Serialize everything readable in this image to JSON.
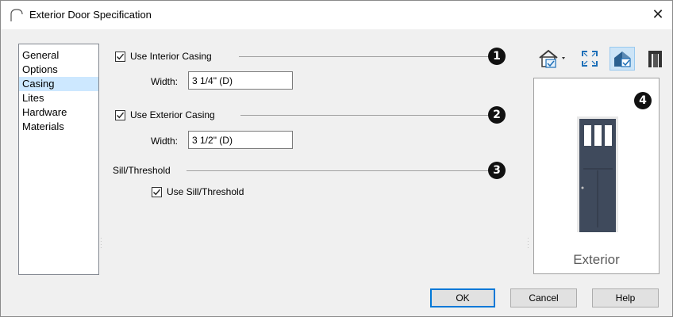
{
  "window": {
    "title": "Exterior Door Specification",
    "close_glyph": "✕"
  },
  "nav": {
    "items": [
      {
        "label": "General",
        "selected": false
      },
      {
        "label": "Options",
        "selected": false
      },
      {
        "label": "Casing",
        "selected": true
      },
      {
        "label": "Lites",
        "selected": false
      },
      {
        "label": "Hardware",
        "selected": false
      },
      {
        "label": "Materials",
        "selected": false
      }
    ]
  },
  "interior_casing": {
    "label": "Use Interior Casing",
    "checked": true,
    "width_label": "Width:",
    "width_value": "3 1/4\" (D)",
    "callout": "1"
  },
  "exterior_casing": {
    "label": "Use Exterior Casing",
    "checked": true,
    "width_label": "Width:",
    "width_value": "3 1/2\" (D)",
    "callout": "2"
  },
  "sill": {
    "group_label": "Sill/Threshold",
    "checkbox_label": "Use Sill/Threshold",
    "checked": true,
    "callout": "3"
  },
  "preview": {
    "caption": "Exterior",
    "callout": "4",
    "door_color": "#3f4a5c"
  },
  "toolbar": {
    "icons": [
      "view-options-dropdown-icon",
      "fill-window-icon",
      "show-preview-icon",
      "door-icon"
    ]
  },
  "buttons": {
    "ok": "OK",
    "cancel": "Cancel",
    "help": "Help"
  }
}
